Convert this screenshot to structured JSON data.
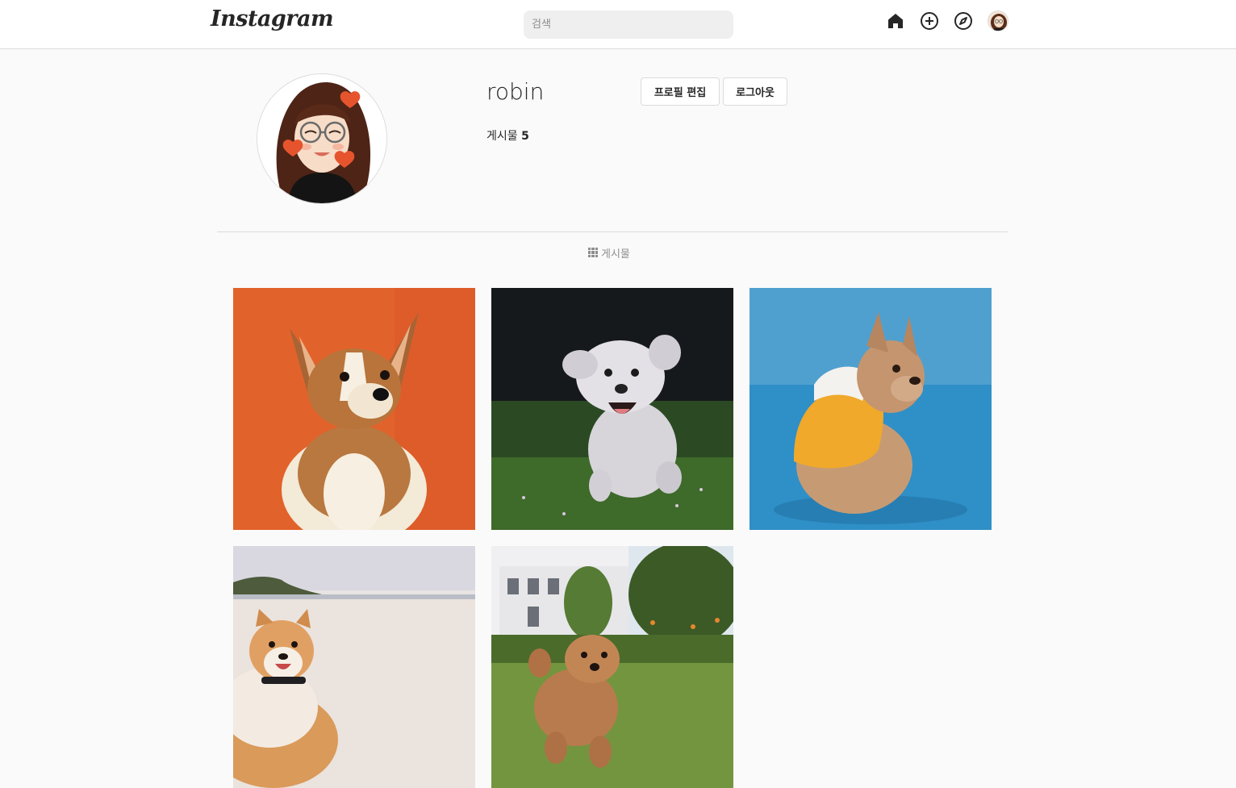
{
  "nav": {
    "logo_text": "Instagram",
    "search_placeholder": "검색",
    "icons": [
      "home-icon",
      "new-post-icon",
      "explore-icon",
      "profile-avatar"
    ]
  },
  "profile": {
    "username": "robin",
    "edit_button": "프로필 편집",
    "logout_button": "로그아웃",
    "posts_label": "게시물",
    "posts_count": "5"
  },
  "tabs": {
    "posts_label": "게시물"
  },
  "posts": [
    {
      "subject": "corgi-puppy",
      "bg": "#e2622b"
    },
    {
      "subject": "white-poodle-running",
      "bg": "#1a1d1f"
    },
    {
      "subject": "french-bulldog-hoodie",
      "bg": "#2a8cc4"
    },
    {
      "subject": "shiba-inu-beach",
      "bg": "#e7e4e2"
    },
    {
      "subject": "toy-poodle-lawn",
      "bg": "#6a8e3a"
    }
  ]
}
